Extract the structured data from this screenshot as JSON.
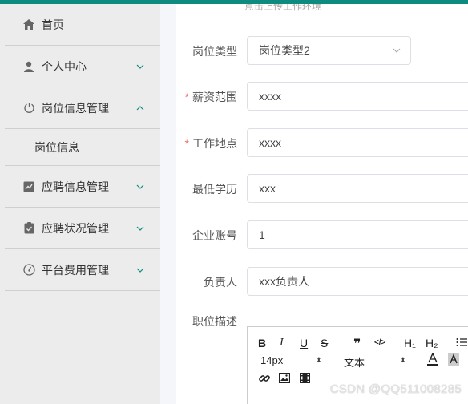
{
  "sidebar": {
    "items": [
      {
        "label": "首页",
        "icon": "home-icon",
        "expandable": false
      },
      {
        "label": "个人中心",
        "icon": "user-icon",
        "expandable": true
      },
      {
        "label": "岗位信息管理",
        "icon": "power-icon",
        "expandable": true,
        "expanded": true,
        "children": [
          {
            "label": "岗位信息"
          }
        ]
      },
      {
        "label": "应聘信息管理",
        "icon": "chart-icon",
        "expandable": true
      },
      {
        "label": "应聘状况管理",
        "icon": "clipboard-icon",
        "expandable": true
      },
      {
        "label": "平台费用管理",
        "icon": "gauge-icon",
        "expandable": true
      }
    ]
  },
  "form": {
    "hint": "点击上传工作环境",
    "fields": [
      {
        "label": "岗位类型",
        "value": "岗位类型2",
        "type": "select",
        "required": false
      },
      {
        "label": "薪资范围",
        "value": "xxxx",
        "type": "input",
        "required": true
      },
      {
        "label": "工作地点",
        "value": "xxxx",
        "type": "input",
        "required": true
      },
      {
        "label": "最低学历",
        "value": "xxx",
        "type": "input",
        "required": false
      },
      {
        "label": "企业账号",
        "value": "1",
        "type": "input",
        "required": false
      },
      {
        "label": "负责人",
        "value": "xxx负责人",
        "type": "input",
        "required": false
      }
    ],
    "description_label": "职位描述",
    "required_mark": "*"
  },
  "editor": {
    "bold": "B",
    "italic": "I",
    "underline": "U",
    "strike": "S",
    "quote": "❞",
    "code": "</>",
    "h1": "H₁",
    "h2": "H₂",
    "font_size": "14px",
    "font_style": "文本"
  },
  "watermark": "CSDN @QQ511008285",
  "colors": {
    "accent": "#0f8a7e",
    "required": "#f56c6c"
  }
}
